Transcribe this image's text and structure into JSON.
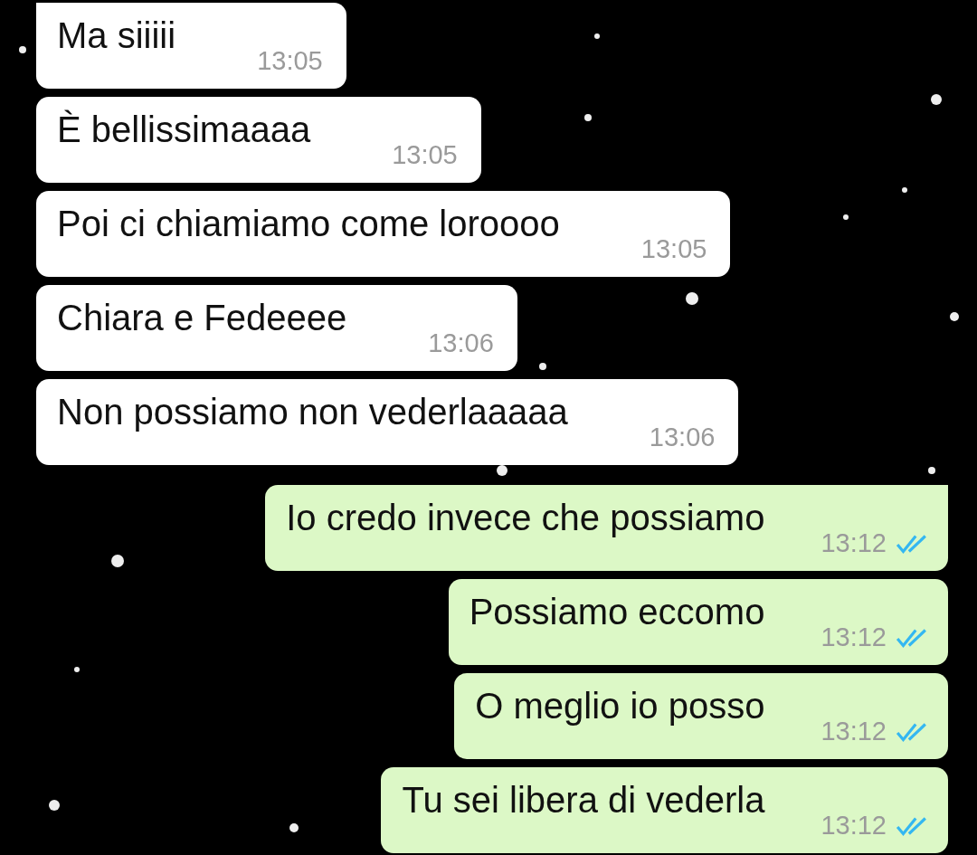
{
  "messages": [
    {
      "kind": "in",
      "tail": true,
      "text": "Ma siiiii",
      "time": "13:05"
    },
    {
      "kind": "in",
      "tail": false,
      "text": "È bellissimaaaa",
      "time": "13:05"
    },
    {
      "kind": "in",
      "tail": false,
      "text": "Poi ci chiamiamo come loroooo",
      "time": "13:05"
    },
    {
      "kind": "in",
      "tail": false,
      "text": "Chiara e Fedeeee",
      "time": "13:06"
    },
    {
      "kind": "in",
      "tail": false,
      "text": "Non possiamo non vederlaaaaa",
      "time": "13:06"
    },
    {
      "kind": "out",
      "tail": true,
      "text": "Io credo invece che possiamo",
      "time": "13:12",
      "read": true
    },
    {
      "kind": "out",
      "tail": false,
      "text": "Possiamo eccomo",
      "time": "13:12",
      "read": true
    },
    {
      "kind": "out",
      "tail": false,
      "text": "O meglio io posso",
      "time": "13:12",
      "read": true
    },
    {
      "kind": "out",
      "tail": false,
      "text": "Tu sei libera di vederla",
      "time": "13:12",
      "read": true
    }
  ]
}
